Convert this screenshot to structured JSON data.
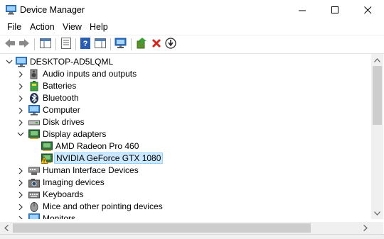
{
  "window": {
    "title": "Device Manager"
  },
  "menu": {
    "file": "File",
    "action": "Action",
    "view": "View",
    "help": "Help"
  },
  "tree": {
    "root": "DESKTOP-AD5LQML",
    "items": [
      {
        "label": "Audio inputs and outputs",
        "icon": "speaker-icon",
        "expanded": false
      },
      {
        "label": "Batteries",
        "icon": "battery-icon",
        "expanded": false
      },
      {
        "label": "Bluetooth",
        "icon": "bluetooth-icon",
        "expanded": false
      },
      {
        "label": "Computer",
        "icon": "computer-icon",
        "expanded": false
      },
      {
        "label": "Disk drives",
        "icon": "disk-drive-icon",
        "expanded": false
      },
      {
        "label": "Display adapters",
        "icon": "display-adapter-icon",
        "expanded": true
      },
      {
        "label": "Human Interface Devices",
        "icon": "hid-icon",
        "expanded": false
      },
      {
        "label": "Imaging devices",
        "icon": "camera-icon",
        "expanded": false
      },
      {
        "label": "Keyboards",
        "icon": "keyboard-icon",
        "expanded": false
      },
      {
        "label": "Mice and other pointing devices",
        "icon": "mouse-icon",
        "expanded": false
      },
      {
        "label": "Monitors",
        "icon": "monitor-icon",
        "expanded": false
      }
    ],
    "display_adapters": [
      {
        "label": "AMD Radeon Pro 460",
        "icon": "display-adapter-icon",
        "selected": false
      },
      {
        "label": "NVIDIA GeForce GTX 1080",
        "icon": "display-adapter-warning-icon",
        "selected": true
      }
    ]
  },
  "colors": {
    "selection_bg": "#cce8ff",
    "selection_border": "#99d1ff",
    "warning": "#f5c518",
    "remove": "#d83b01"
  }
}
